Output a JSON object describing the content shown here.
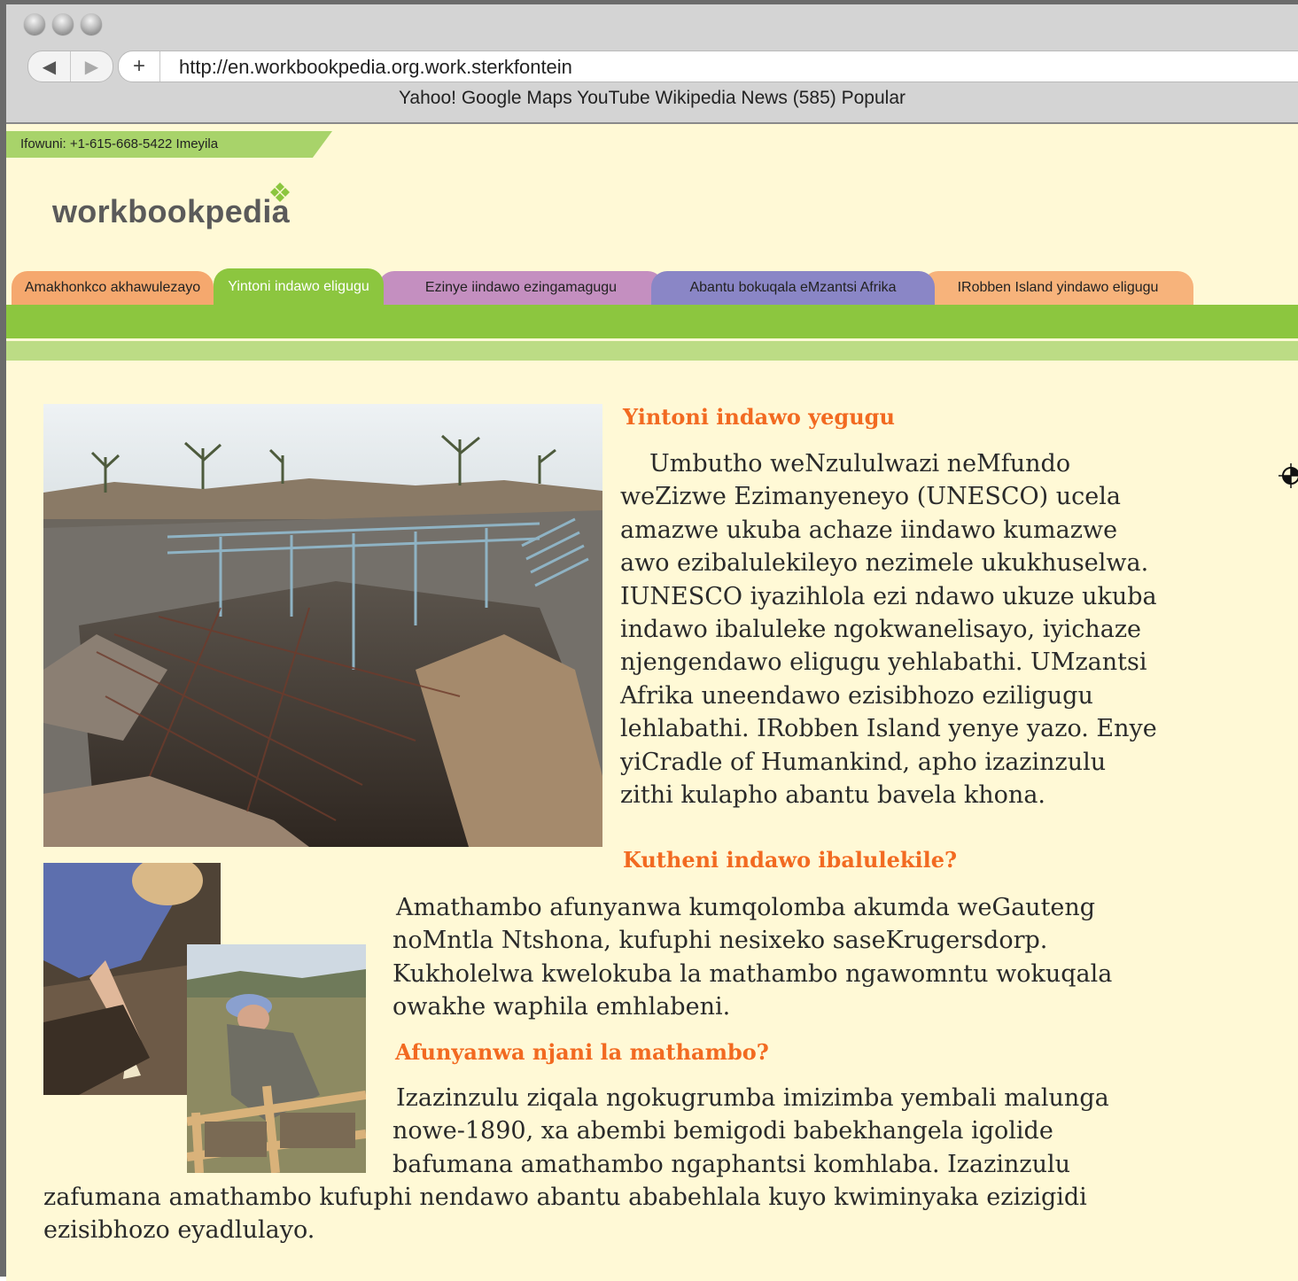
{
  "browser": {
    "url": "http://en.workbookpedia.org.work.sterkfontein",
    "add_label": "+",
    "back_label": "◀",
    "forward_label": "▶",
    "bookmarks": "Yahoo! Google Maps YouTube Wikipedia News (585) Popular"
  },
  "site": {
    "contact": "Ifowuni: +1-615-668-5422 Imeyila",
    "logo": "workbookpedia",
    "colors": {
      "accent": "#f26a21",
      "green": "#8cc63f",
      "page_bg": "#fff9d6"
    }
  },
  "tabs": [
    {
      "label": "Amakhonkco akhawulezayo",
      "color": "#f5a86e"
    },
    {
      "label": "Yintoni indawo eligugu",
      "color": "#8cc63f",
      "active": true
    },
    {
      "label": "Ezinye iindawo ezingamagugu",
      "color": "#c48fc0"
    },
    {
      "label": "Abantu bokuqala eMzantsi Afrika",
      "color": "#8a86c6"
    },
    {
      "label": "IRobben Island yindawo eligugu",
      "color": "#f7b37b"
    }
  ],
  "article": {
    "h1": "Yintoni indawo yegugu",
    "p1": [
      "Umbutho weNzululwazi neMfundo",
      "weZizwe Ezimanyeneyo (UNESCO) ucela",
      "amazwe ukuba achaze iindawo kumazwe",
      "awo ezibalulekileyo nezimele ukukhuselwa.",
      "IUNESCO iyazihlola ezi ndawo ukuze ukuba",
      "indawo ibaluleke ngokwanelisayo, iyichaze",
      "njengendawo eligugu yehlabathi. UMzantsi",
      "Afrika uneendawo ezisibhozo eziligugu",
      "lehlabathi. IRobben Island yenye yazo. Enye",
      "yiCradle of Humankind, apho izazinzulu",
      "zithi kulapho abantu bavela khona."
    ],
    "h2": "Kutheni indawo ibalulekile?",
    "p2": [
      "Amathambo afunyanwa kumqolomba akumda weGauteng",
      "noMntla Ntshona, kufuphi nesixeko saseKrugersdorp.",
      "Kukholelwa kwelokuba la mathambo ngawomntu wokuqala",
      "owakhe waphila emhlabeni."
    ],
    "h3": "Afunyanwa njani la mathambo?",
    "p3": [
      "Izazinzulu ziqala ngokugrumba imizimba yembali malunga",
      "nowe-1890, xa abembi bemigodi babekhangela igolide",
      "bafumana amathambo ngaphantsi komhlaba. Izazinzulu"
    ],
    "p3_full": [
      "zafumana amathambo kufuphi nendawo abantu ababehlala kuyo kwiminyaka ezizigidi",
      "ezisibhozo eyadlulayo."
    ]
  }
}
